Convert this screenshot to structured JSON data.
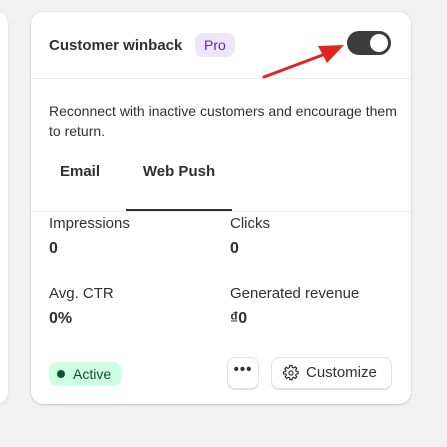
{
  "card": {
    "title": "Customer winback",
    "badge": "Pro",
    "toggle_on": true,
    "description": "Reconnect with inactive customers and encourage them to return."
  },
  "tabs": [
    {
      "label": "Email",
      "selected": false
    },
    {
      "label": "Web Push",
      "selected": true
    }
  ],
  "stats": [
    {
      "label": "Impressions",
      "value": "0"
    },
    {
      "label": "Clicks",
      "value": "0"
    },
    {
      "label": "Avg. CTR",
      "value": "0%"
    },
    {
      "label": "Generated revenue",
      "value": "₫0"
    }
  ],
  "footer": {
    "status": "Active",
    "more_label": "•••",
    "customize_label": "Customize"
  },
  "colors": {
    "arrow": "#e02424",
    "badge_pro_bg": "#eee6fd",
    "status_active_bg": "#cdfee1"
  }
}
